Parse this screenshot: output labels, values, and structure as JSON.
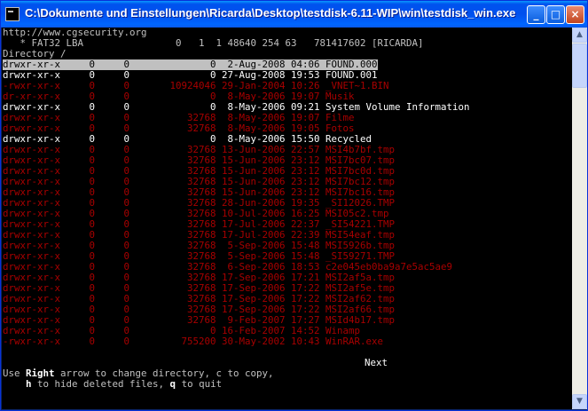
{
  "window": {
    "title": "C:\\Dokumente und Einstellungen\\Ricarda\\Desktop\\testdisk-6.11-WIP\\win\\testdisk_win.exe"
  },
  "titlebar_buttons": {
    "minimize": "_",
    "maximize": "□",
    "close": "×"
  },
  "scrollbar": {
    "up": "▲",
    "down": "▼"
  },
  "header": {
    "url": "http://www.cgsecurity.org",
    "partition": "   * FAT32 LBA                0   1  1 48640 254 63   781417602 [RICARDA]",
    "directory": "Directory /"
  },
  "files": [
    {
      "perm": "drwxr-xr-x",
      "uid": "0",
      "gid": "0",
      "size": "0",
      "date": "2-Aug-2008",
      "time": "04:06",
      "name": "FOUND.000",
      "status": "selected"
    },
    {
      "perm": "drwxr-xr-x",
      "uid": "0",
      "gid": "0",
      "size": "0",
      "date": "27-Aug-2008",
      "time": "19:53",
      "name": "FOUND.001",
      "status": "normal"
    },
    {
      "perm": "-rwxr-xr-x",
      "uid": "0",
      "gid": "0",
      "size": "10924046",
      "date": "29-Jan-2004",
      "time": "10:26",
      "name": "_VNET~1.BIN",
      "status": "deleted"
    },
    {
      "perm": "dr-xr-xr-x",
      "uid": "0",
      "gid": "0",
      "size": "0",
      "date": "8-May-2006",
      "time": "19:07",
      "name": "Musik",
      "status": "deleted"
    },
    {
      "perm": "drwxr-xr-x",
      "uid": "0",
      "gid": "0",
      "size": "0",
      "date": "8-May-2006",
      "time": "09:21",
      "name": "System Volume Information",
      "status": "normal"
    },
    {
      "perm": "drwxr-xr-x",
      "uid": "0",
      "gid": "0",
      "size": "32768",
      "date": "8-May-2006",
      "time": "19:07",
      "name": "Filme",
      "status": "deleted"
    },
    {
      "perm": "drwxr-xr-x",
      "uid": "0",
      "gid": "0",
      "size": "32768",
      "date": "8-May-2006",
      "time": "19:05",
      "name": "Fotos",
      "status": "deleted"
    },
    {
      "perm": "drwxr-xr-x",
      "uid": "0",
      "gid": "0",
      "size": "0",
      "date": "8-May-2006",
      "time": "15:50",
      "name": "Recycled",
      "status": "normal"
    },
    {
      "perm": "drwxr-xr-x",
      "uid": "0",
      "gid": "0",
      "size": "32768",
      "date": "13-Jun-2006",
      "time": "22:57",
      "name": "MSI4b7bf.tmp",
      "status": "deleted"
    },
    {
      "perm": "drwxr-xr-x",
      "uid": "0",
      "gid": "0",
      "size": "32768",
      "date": "15-Jun-2006",
      "time": "23:12",
      "name": "MSI7bc07.tmp",
      "status": "deleted"
    },
    {
      "perm": "drwxr-xr-x",
      "uid": "0",
      "gid": "0",
      "size": "32768",
      "date": "15-Jun-2006",
      "time": "23:12",
      "name": "MSI7bc0d.tmp",
      "status": "deleted"
    },
    {
      "perm": "drwxr-xr-x",
      "uid": "0",
      "gid": "0",
      "size": "32768",
      "date": "15-Jun-2006",
      "time": "23:12",
      "name": "MSI7bc12.tmp",
      "status": "deleted"
    },
    {
      "perm": "drwxr-xr-x",
      "uid": "0",
      "gid": "0",
      "size": "32768",
      "date": "15-Jun-2006",
      "time": "23:12",
      "name": "MSI7bc16.tmp",
      "status": "deleted"
    },
    {
      "perm": "drwxr-xr-x",
      "uid": "0",
      "gid": "0",
      "size": "32768",
      "date": "28-Jun-2006",
      "time": "19:35",
      "name": "_SI12026.TMP",
      "status": "deleted"
    },
    {
      "perm": "drwxr-xr-x",
      "uid": "0",
      "gid": "0",
      "size": "32768",
      "date": "10-Jul-2006",
      "time": "16:25",
      "name": "MSI05c2.tmp",
      "status": "deleted"
    },
    {
      "perm": "drwxr-xr-x",
      "uid": "0",
      "gid": "0",
      "size": "32768",
      "date": "17-Jul-2006",
      "time": "22:37",
      "name": "_SI54221.TMP",
      "status": "deleted"
    },
    {
      "perm": "drwxr-xr-x",
      "uid": "0",
      "gid": "0",
      "size": "32768",
      "date": "17-Jul-2006",
      "time": "22:39",
      "name": "MSI54eaf.tmp",
      "status": "deleted"
    },
    {
      "perm": "drwxr-xr-x",
      "uid": "0",
      "gid": "0",
      "size": "32768",
      "date": "5-Sep-2006",
      "time": "15:48",
      "name": "MSI5926b.tmp",
      "status": "deleted"
    },
    {
      "perm": "drwxr-xr-x",
      "uid": "0",
      "gid": "0",
      "size": "32768",
      "date": "5-Sep-2006",
      "time": "15:48",
      "name": "_SI59271.TMP",
      "status": "deleted"
    },
    {
      "perm": "drwxr-xr-x",
      "uid": "0",
      "gid": "0",
      "size": "32768",
      "date": "6-Sep-2006",
      "time": "18:53",
      "name": "c2e045eb0ba9a7e5ac5ae9",
      "status": "deleted"
    },
    {
      "perm": "drwxr-xr-x",
      "uid": "0",
      "gid": "0",
      "size": "32768",
      "date": "17-Sep-2006",
      "time": "17:21",
      "name": "MSI2af5a.tmp",
      "status": "deleted"
    },
    {
      "perm": "drwxr-xr-x",
      "uid": "0",
      "gid": "0",
      "size": "32768",
      "date": "17-Sep-2006",
      "time": "17:22",
      "name": "MSI2af5e.tmp",
      "status": "deleted"
    },
    {
      "perm": "drwxr-xr-x",
      "uid": "0",
      "gid": "0",
      "size": "32768",
      "date": "17-Sep-2006",
      "time": "17:22",
      "name": "MSI2af62.tmp",
      "status": "deleted"
    },
    {
      "perm": "drwxr-xr-x",
      "uid": "0",
      "gid": "0",
      "size": "32768",
      "date": "17-Sep-2006",
      "time": "17:22",
      "name": "MSI2af66.tmp",
      "status": "deleted"
    },
    {
      "perm": "drwxr-xr-x",
      "uid": "0",
      "gid": "0",
      "size": "32768",
      "date": "9-Feb-2007",
      "time": "17:27",
      "name": "MSId4b17.tmp",
      "status": "deleted"
    },
    {
      "perm": "drwxr-xr-x",
      "uid": "0",
      "gid": "0",
      "size": "0",
      "date": "16-Feb-2007",
      "time": "14:52",
      "name": "Winamp",
      "status": "deleted"
    },
    {
      "perm": "-rwxr-xr-x",
      "uid": "0",
      "gid": "0",
      "size": "755200",
      "date": "30-May-2002",
      "time": "10:43",
      "name": "WinRAR.exe",
      "status": "deleted"
    }
  ],
  "footer": {
    "next": "Next",
    "help_line1_prefix": "Use ",
    "help_line1_key": "Right",
    "help_line1_rest": " arrow to change directory, c to copy,",
    "help_line2_indent": "    ",
    "help_line2_key1": "h",
    "help_line2_mid": " to hide deleted files, ",
    "help_line2_key2": "q",
    "help_line2_rest": " to quit"
  }
}
